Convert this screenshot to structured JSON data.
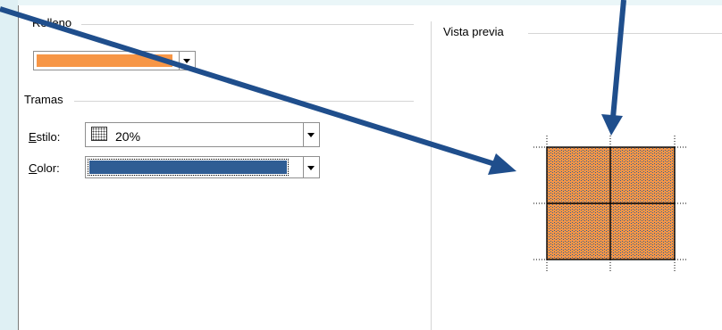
{
  "fill_section": {
    "label": "Relleno",
    "color_value": "#f79646"
  },
  "patterns_section": {
    "label": "Tramas",
    "style_label_mnemonic": "E",
    "style_label_rest": "stilo:",
    "style_value": "20%",
    "color_label_mnemonic": "C",
    "color_label_rest": "olor:",
    "color_value": "#2f5d94"
  },
  "preview_section": {
    "label": "Vista previa"
  },
  "colors": {
    "fill": "#f79646",
    "pattern_color": "#2f5d94",
    "arrow": "#1f4e8c"
  }
}
